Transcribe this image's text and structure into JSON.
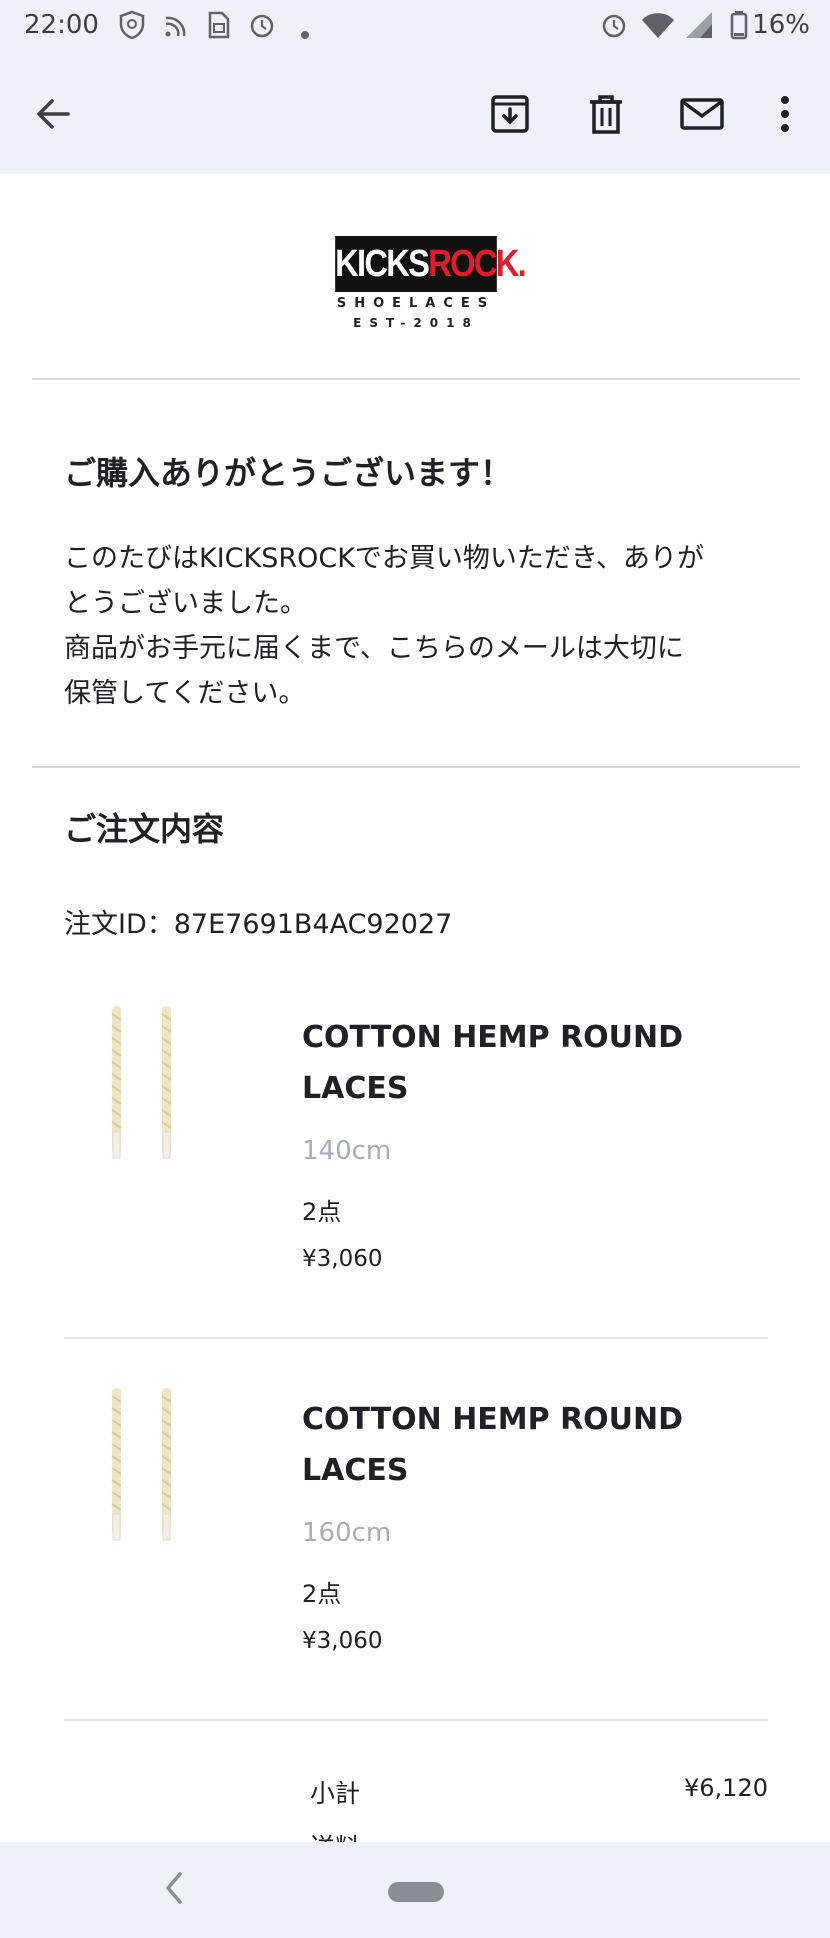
{
  "status_bar": {
    "time": "22:00",
    "battery_percent": "16%",
    "icons": [
      "shield-icon",
      "nfc-icon",
      "sim-icon",
      "alarm-icon",
      "dot-icon",
      "alarm-icon",
      "wifi-icon",
      "signal-icon",
      "battery-icon"
    ]
  },
  "toolbar": {
    "back_icon": "arrow-left-icon",
    "archive_icon": "archive-icon",
    "delete_icon": "trash-icon",
    "mail_icon": "mail-icon",
    "more_icon": "more-vert-icon"
  },
  "email": {
    "logo": {
      "part1": "KICKS",
      "part2": "ROCK.",
      "line1": "SHOELACES",
      "line2": "EST-2018",
      "accent_color": "#e51a2a"
    },
    "thanks_title": "ご購入ありがとうございます！",
    "thanks_lines": [
      "このたびはKICKSROCKでお買い物いただき、ありが",
      "とうございました。",
      "商品がお手元に届くまで、こちらのメールは大切に",
      "保管してください。"
    ],
    "order_section_title": "ご注文内容",
    "order_id": "注文ID：87E7691B4AC92027",
    "products": [
      {
        "name_line1": "COTTON HEMP ROUND",
        "name_line2": "LACES",
        "size": "140cm",
        "quantity": "2点",
        "price": "¥3,060"
      },
      {
        "name_line1": "COTTON HEMP ROUND",
        "name_line2": "LACES",
        "size": "160cm",
        "quantity": "2点",
        "price": "¥3,060"
      }
    ],
    "summary": {
      "subtotal_label": "小計",
      "subtotal_value": "¥6,120",
      "next_label": "送料"
    }
  },
  "nav_bar": {
    "back_icon": "nav-back-icon",
    "home_icon": "home-pill-icon"
  }
}
